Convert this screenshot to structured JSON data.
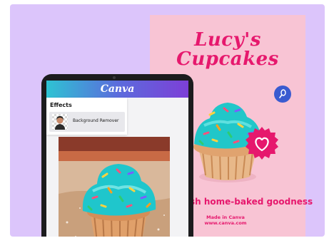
{
  "poster": {
    "title_line1": "Lucy's",
    "title_line2": "Cupcakes",
    "tagline": "sh home-baked goodness",
    "made_line1": "Made in Canva",
    "made_line2": "www.canva.com",
    "accent_color": "#e6186d",
    "background_color": "#f8c4d4",
    "icons": [
      "whisk-icon",
      "heart-icon"
    ]
  },
  "tablet": {
    "app_logo": "Canva",
    "effects_panel": {
      "title": "Effects",
      "items": [
        {
          "label": "Background Remover",
          "icon": "portrait-thumbnail"
        }
      ]
    }
  },
  "colors": {
    "backdrop": "#dcc5fb",
    "topbar_gradient": [
      "#2ec3d3",
      "#5b6cdc",
      "#7d3fd7"
    ]
  }
}
